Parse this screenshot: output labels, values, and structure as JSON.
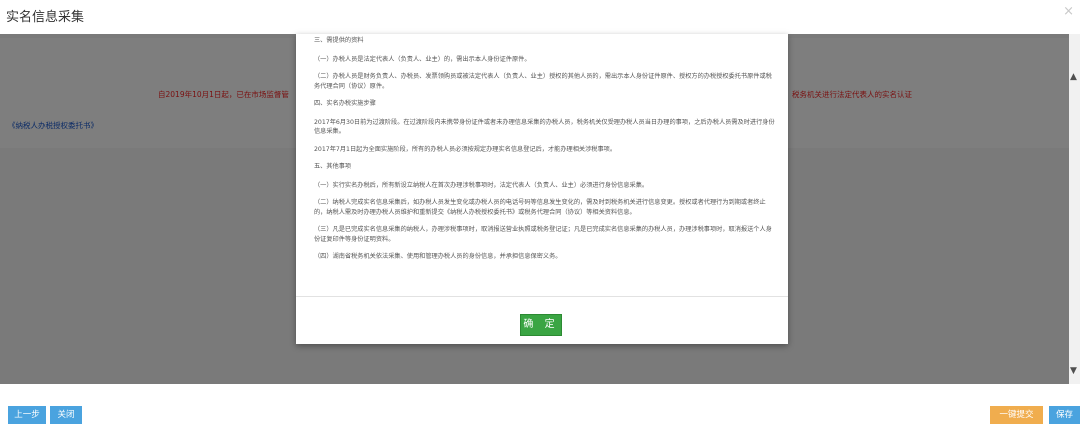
{
  "window": {
    "title": "实名信息采集",
    "close": "×"
  },
  "background": {
    "notice_left": "自2019年10月1日起，已在市场监督管",
    "notice_right": "税务机关进行法定代表人的实名认证",
    "link": "《纳税人办税授权委托书》"
  },
  "dialog": {
    "paragraphs": [
      "三、需提供的资料",
      "（一）办税人员是法定代表人（负责人、业主）的，需出示本人身份证件原件。",
      "（二）办税人员是财务负责人、办税员、发票领购员或被法定代表人（负责人、业主）授权的其他人员的，需出示本人身份证件原件、授权方的办税授权委托书原件或税务代理合同（协议）原件。",
      "四、实名办税实施步骤",
      "2017年6月30日前为过渡阶段。在过渡阶段内未携带身份证件或者未办理信息采集的办税人员，税务机关仅受理办税人员当日办理的事项，之后办税人员需及时进行身份信息采集。",
      "2017年7月1日起为全面实施阶段，所有的办税人员必须按规定办理实名信息登记后，才能办理相关涉税事项。",
      "五、其他事项",
      "（一）实行实名办税后，所有新设立纳税人在首次办理涉税事项时，法定代表人（负责人、业主）必须进行身份信息采集。",
      "（二）纳税人完成实名信息采集后，如办税人员发生变化或办税人员的电话号码等信息发生变化的，需及时到税务机关进行信息变更。授权或者代理行为到期或者终止的，纳税人需及时办理办税人员维护和重新提交《纳税人办税授权委托书》或税务代理合同（协议）等相关资料信息。",
      "（三）凡是已完成实名信息采集的纳税人，办理涉税事项时，取消报送营业执照或税务登记证；凡是已完成实名信息采集的办税人员，办理涉税事项时，取消报送个人身份证复印件等身份证明资料。",
      "（四）湖南省税务机关依法采集、使用和管理办税人员的身份信息，并承担信息保密义务。"
    ],
    "ok_label": "确 定"
  },
  "footer": {
    "prev_label": "上一步",
    "close_label": "关闭",
    "submit_label": "一键提交",
    "save_label": "保存"
  }
}
